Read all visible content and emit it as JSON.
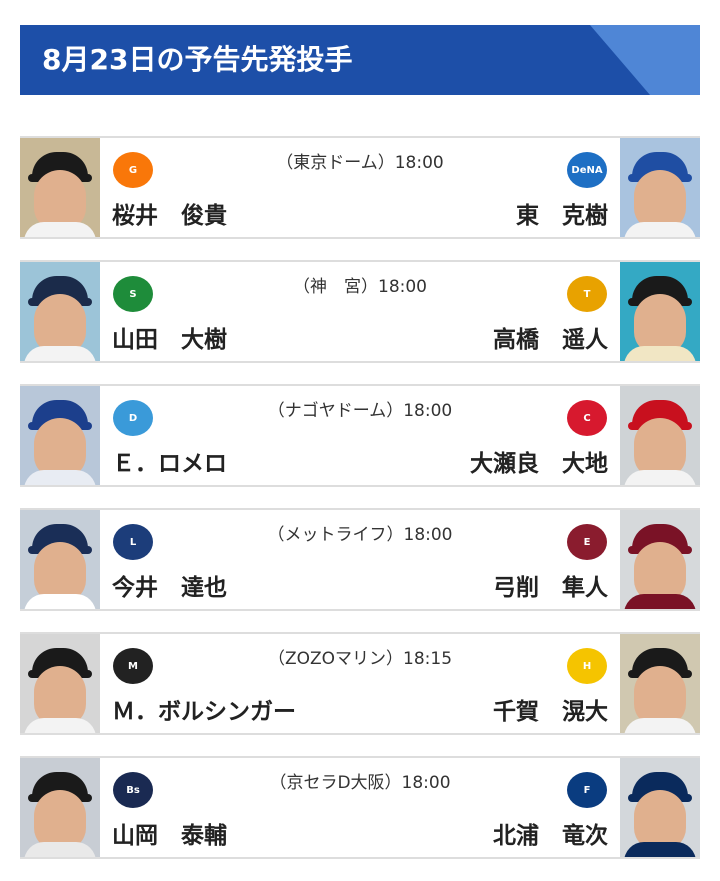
{
  "header": {
    "title": "8月23日の予告先発投手"
  },
  "games": [
    {
      "venue": "（東京ドーム）18:00",
      "home_pitcher": "桜井　俊貴",
      "away_pitcher": "東　克樹",
      "home_logo_text": "G",
      "away_logo_text": "DeNA",
      "colors": {
        "home_logo": "#f97709",
        "away_logo": "#1e6fc4",
        "home_cap": "#1a1a1a",
        "away_cap": "#1f4ea3",
        "home_body": "#f3f3f3",
        "away_body": "#f3f3f3",
        "home_bg": "#c8b896",
        "away_bg": "#a9c3df"
      }
    },
    {
      "venue": "（神　宮）18:00",
      "home_pitcher": "山田　大樹",
      "away_pitcher": "高橋　遥人",
      "home_logo_text": "S",
      "away_logo_text": "T",
      "colors": {
        "home_logo": "#1e8c3a",
        "away_logo": "#e8a200",
        "home_cap": "#1b2b4a",
        "away_cap": "#1a1a1a",
        "home_body": "#f3f3f3",
        "away_body": "#f1e6c4",
        "home_bg": "#9cc4d8",
        "away_bg": "#34a9c4"
      }
    },
    {
      "venue": "（ナゴヤドーム）18:00",
      "home_pitcher": "Ｅ．ロメロ",
      "away_pitcher": "大瀬良　大地",
      "home_logo_text": "D",
      "away_logo_text": "C",
      "colors": {
        "home_logo": "#3a9ad9",
        "away_logo": "#d7192e",
        "home_cap": "#1c3f8c",
        "away_cap": "#c8101e",
        "home_body": "#e8ecf3",
        "away_body": "#f3f3f3",
        "home_bg": "#b8c7d9",
        "away_bg": "#cfd3d6"
      }
    },
    {
      "venue": "（メットライフ）18:00",
      "home_pitcher": "今井　達也",
      "away_pitcher": "弓削　隼人",
      "home_logo_text": "L",
      "away_logo_text": "E",
      "colors": {
        "home_logo": "#1c3d7a",
        "away_logo": "#8a1c2e",
        "home_cap": "#1a2e57",
        "away_cap": "#7a1226",
        "home_body": "#ffffff",
        "away_body": "#7a1226",
        "home_bg": "#c5ced8",
        "away_bg": "#d6d9db"
      }
    },
    {
      "venue": "（ZOZOマリン）18:15",
      "home_pitcher": "Ｍ．ボルシンガー",
      "away_pitcher": "千賀　滉大",
      "home_logo_text": "M",
      "away_logo_text": "H",
      "colors": {
        "home_logo": "#222222",
        "away_logo": "#f5c400",
        "home_cap": "#1a1a1a",
        "away_cap": "#1a1a1a",
        "home_body": "#f3f3f3",
        "away_body": "#f3f3f3",
        "home_bg": "#d6d6d6",
        "away_bg": "#d0c8b0"
      }
    },
    {
      "venue": "（京セラD大阪）18:00",
      "home_pitcher": "山岡　泰輔",
      "away_pitcher": "北浦　竜次",
      "home_logo_text": "Bs",
      "away_logo_text": "F",
      "colors": {
        "home_logo": "#1a2a52",
        "away_logo": "#0a3c80",
        "home_cap": "#1a1a1a",
        "away_cap": "#0a2a5c",
        "home_body": "#e9e9e9",
        "away_body": "#0a2a5c",
        "home_bg": "#c8cdd4",
        "away_bg": "#d3d7db"
      }
    }
  ]
}
